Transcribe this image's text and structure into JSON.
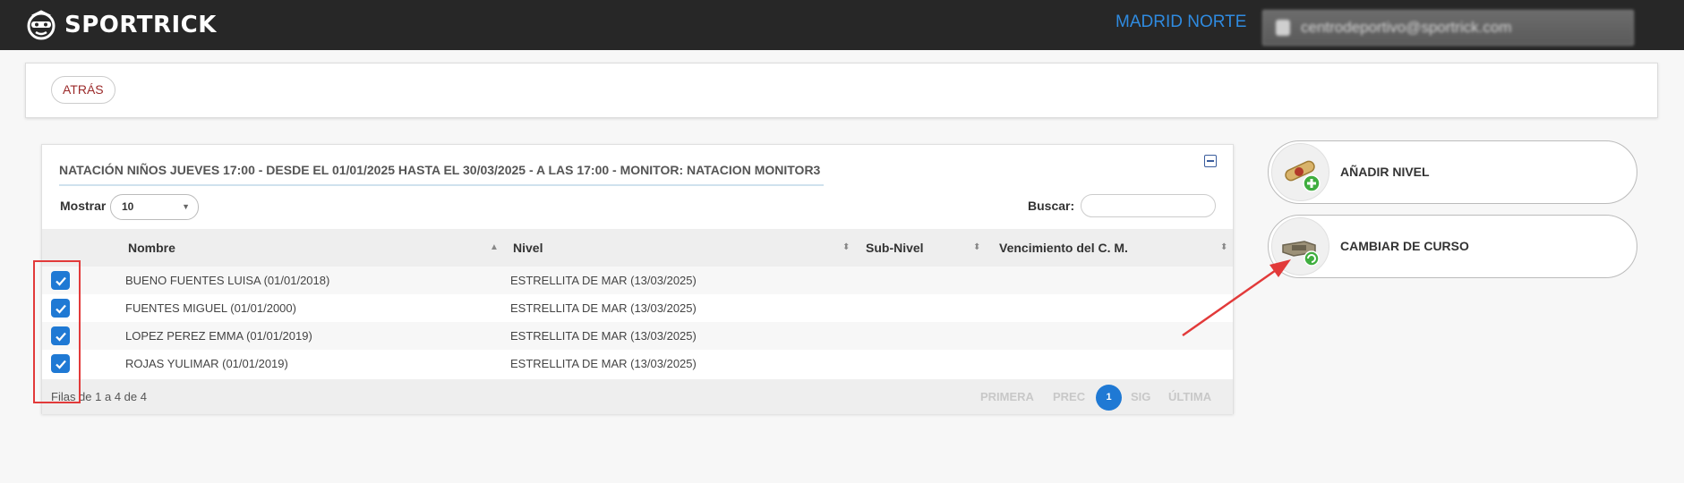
{
  "header": {
    "brand": "SPORTRICK",
    "center": "MADRID NORTE",
    "user": "centrodeportivo@sportrick.com"
  },
  "back": {
    "label": "ATRÁS"
  },
  "card": {
    "title": "NATACIÓN NIÑOS JUEVES 17:00 - DESDE EL 01/01/2025 HASTA EL 30/03/2025 - A LAS 17:00 - MONITOR: NATACION MONITOR3",
    "show_label": "Mostrar",
    "show_value": "10",
    "search_label": "Buscar:",
    "columns": [
      "Nombre",
      "Nivel",
      "Sub-Nivel",
      "Vencimiento del C. M."
    ],
    "rows": [
      {
        "nombre": "BUENO FUENTES LUISA (01/01/2018)",
        "nivel": "ESTRELLITA DE MAR (13/03/2025)",
        "subnivel": "",
        "venc": "",
        "checked": true
      },
      {
        "nombre": "FUENTES MIGUEL (01/01/2000)",
        "nivel": "ESTRELLITA DE MAR (13/03/2025)",
        "subnivel": "",
        "venc": "",
        "checked": true
      },
      {
        "nombre": "LOPEZ PEREZ EMMA (01/01/2019)",
        "nivel": "ESTRELLITA DE MAR (13/03/2025)",
        "subnivel": "",
        "venc": "",
        "checked": true
      },
      {
        "nombre": "ROJAS YULIMAR (01/01/2019)",
        "nivel": "ESTRELLITA DE MAR (13/03/2025)",
        "subnivel": "",
        "venc": "",
        "checked": true
      }
    ],
    "footer_info": "Filas de 1 a 4 de 4",
    "pager": {
      "first": "PRIMERA",
      "prev": "PREC",
      "current": "1",
      "next": "SIG",
      "last": "ÚLTIMA"
    }
  },
  "actions": {
    "add_level": "AÑADIR NIVEL",
    "change_course": "CAMBIAR DE CURSO"
  },
  "colors": {
    "accent": "#1f79d4",
    "header_bg": "#272727",
    "center_link": "#2f8be0",
    "highlight": "#e23a3a"
  }
}
